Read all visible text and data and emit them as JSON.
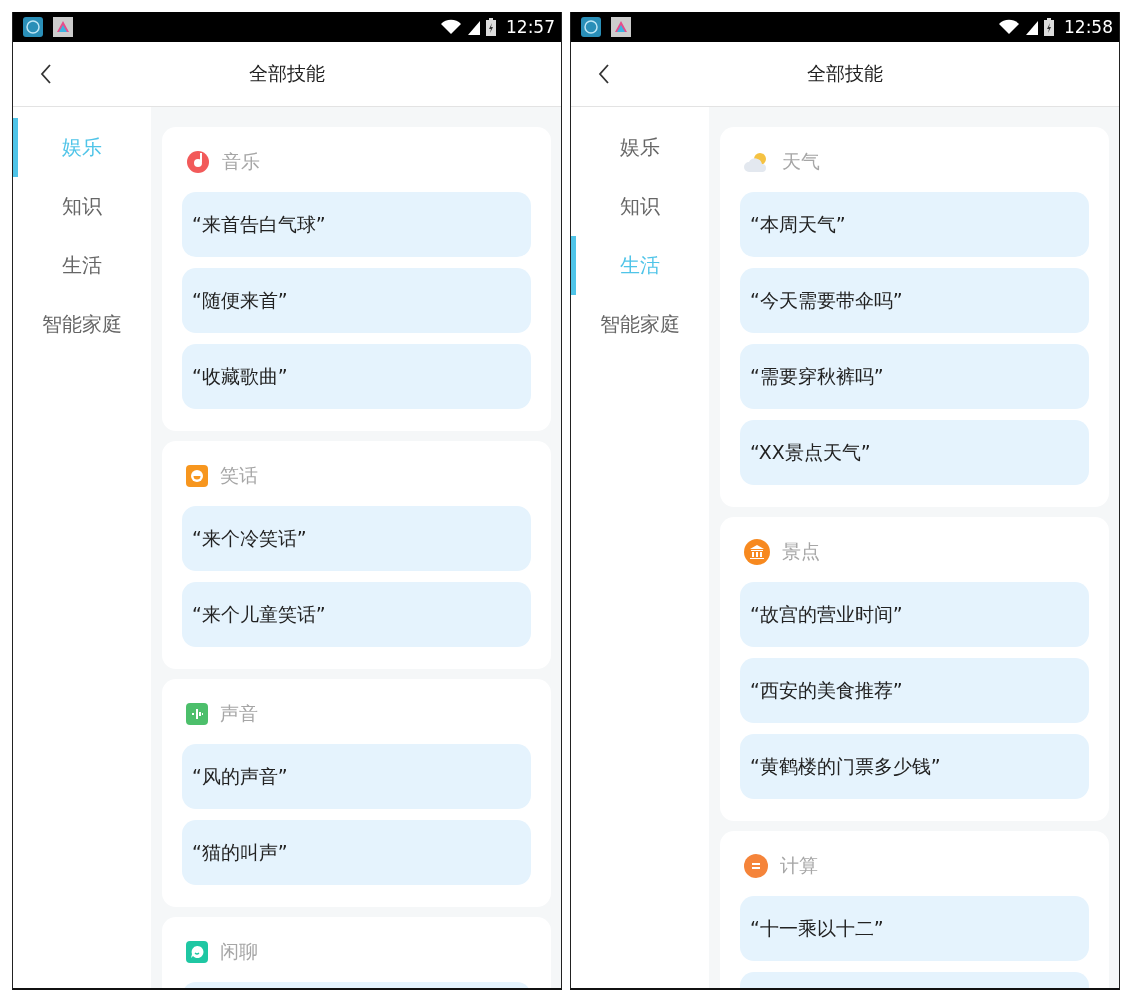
{
  "screens": [
    {
      "status_bar": {
        "time": "12:57"
      },
      "title": "全部技能",
      "categories": [
        {
          "label": "娱乐",
          "selected": true
        },
        {
          "label": "知识",
          "selected": false
        },
        {
          "label": "生活",
          "selected": false
        },
        {
          "label": "智能家庭",
          "selected": false
        }
      ],
      "sections": [
        {
          "kind": "music",
          "title": "音乐",
          "examples": [
            "“来首告白气球”",
            "“随便来首”",
            "“收藏歌曲”"
          ],
          "cut_off_bubble": false
        },
        {
          "kind": "joke",
          "title": "笑话",
          "examples": [
            "“来个冷笑话”",
            "“来个儿童笑话”"
          ],
          "cut_off_bubble": false
        },
        {
          "kind": "sound",
          "title": "声音",
          "examples": [
            "“风的声音”",
            "“猫的叫声”"
          ],
          "cut_off_bubble": false
        },
        {
          "kind": "chat",
          "title": "闲聊",
          "cut_off_bubble": true
        }
      ]
    },
    {
      "status_bar": {
        "time": "12:58"
      },
      "title": "全部技能",
      "categories": [
        {
          "label": "娱乐",
          "selected": false
        },
        {
          "label": "知识",
          "selected": false
        },
        {
          "label": "生活",
          "selected": true
        },
        {
          "label": "智能家庭",
          "selected": false
        }
      ],
      "sections": [
        {
          "kind": "weather",
          "title": "天气",
          "examples": [
            "“本周天气”",
            "“今天需要带伞吗”",
            "“需要穿秋裤吗”",
            "“XX景点天气”"
          ],
          "cut_off_bubble": false
        },
        {
          "kind": "landmark",
          "title": "景点",
          "examples": [
            "“故宫的营业时间”",
            "“西安的美食推荐”",
            "“黄鹤楼的门票多少钱”"
          ],
          "cut_off_bubble": false
        },
        {
          "kind": "calc",
          "title": "计算",
          "examples": [
            "“十一乘以十二”"
          ],
          "cut_off_bubble": true
        }
      ]
    }
  ]
}
